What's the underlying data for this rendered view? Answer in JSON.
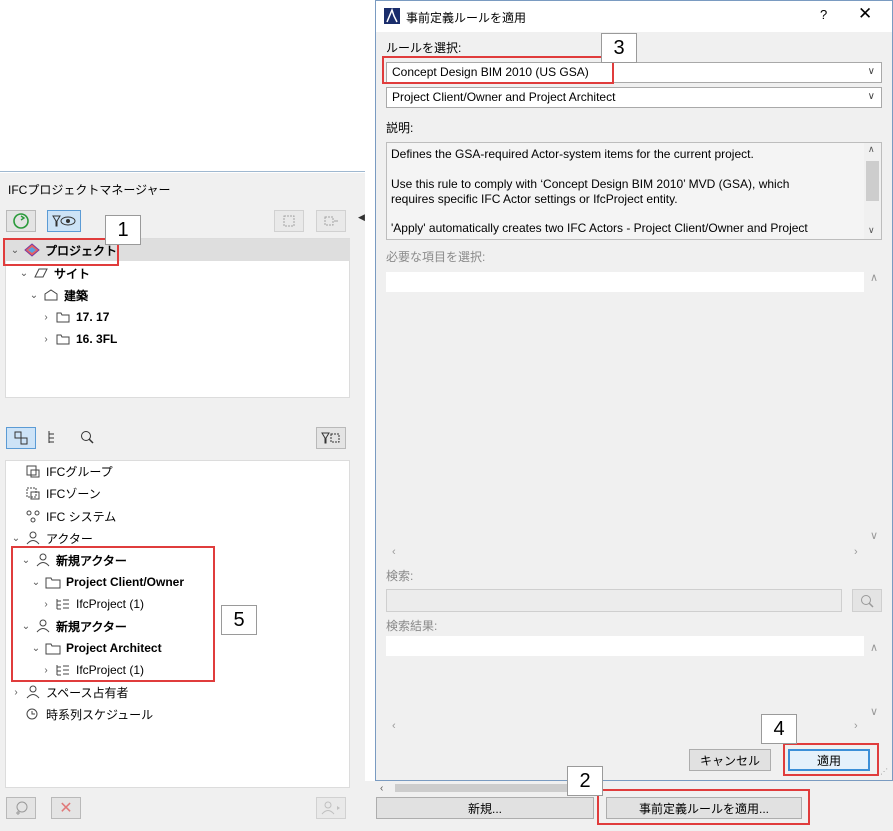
{
  "manager": {
    "title": "IFCプロジェクトマネージャー",
    "top_tree": [
      {
        "label": "プロジェクト",
        "bold": true
      },
      {
        "label": "サイト",
        "bold": true
      },
      {
        "label": "建築",
        "bold": true
      },
      {
        "label": "17. 17",
        "bold": true
      },
      {
        "label": "16. 3FL",
        "bold": true
      }
    ],
    "bottom_tree": [
      {
        "label": "IFCグループ"
      },
      {
        "label": "IFCゾーン"
      },
      {
        "label": "IFC システム"
      },
      {
        "label": "アクター"
      },
      {
        "label": "新規アクター"
      },
      {
        "label": "Project Client/Owner"
      },
      {
        "label": "IfcProject (1)"
      },
      {
        "label": "新規アクター"
      },
      {
        "label": "Project Architect"
      },
      {
        "label": "IfcProject (1)"
      },
      {
        "label": "スペース占有者"
      },
      {
        "label": "時系列スケジュール"
      }
    ]
  },
  "dialog": {
    "title": "事前定義ルールを適用",
    "help": "?",
    "close": "✕",
    "rule_label": "ルールを選択:",
    "rule_value": "Concept Design BIM 2010 (US GSA)",
    "sub_value": "Project Client/Owner and Project Architect",
    "desc_label": "説明:",
    "desc_lines": [
      "Defines the GSA-required Actor-system items for the current project.",
      "Use this rule to comply with ‘Concept Design BIM 2010’ MVD (GSA), which",
      "requires specific IFC Actor settings or IfcProject entity.",
      "'Apply' automatically creates two IFC Actors - Project Client/Owner and Project"
    ],
    "required_label": "必要な項目を選択:",
    "search_label": "検索:",
    "results_label": "検索結果:",
    "cancel": "キャンセル",
    "apply": "適用"
  },
  "bottom_buttons": {
    "new": "新規...",
    "apply_rule": "事前定義ルールを適用..."
  },
  "callouts": [
    "1",
    "2",
    "3",
    "4",
    "5"
  ],
  "colors": {
    "callout_red": "#e03c3c",
    "accent_blue": "#3c8fd8"
  }
}
